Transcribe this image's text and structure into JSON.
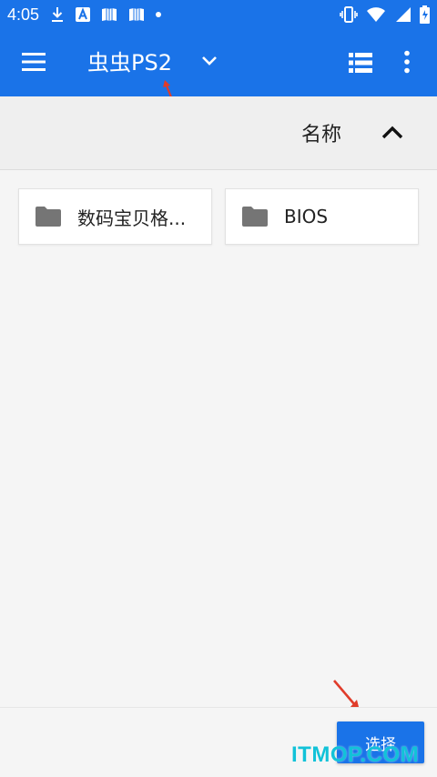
{
  "status_bar": {
    "time": "4:05",
    "icons": [
      "download-icon",
      "a-badge-icon",
      "book-icon",
      "book-icon",
      "dot-icon",
      "vibrate-icon",
      "wifi-icon",
      "signal-icon",
      "battery-icon"
    ]
  },
  "app_bar": {
    "title": "虫虫PS2",
    "icons": [
      "menu-icon",
      "chevron-down-icon",
      "list-view-icon",
      "more-vert-icon"
    ],
    "color": "#1a73e8"
  },
  "sort_bar": {
    "label": "名称",
    "direction_icon": "chevron-up-icon"
  },
  "items": [
    {
      "name": "数码宝贝格...",
      "icon": "folder-icon"
    },
    {
      "name": "BIOS",
      "icon": "folder-icon"
    }
  ],
  "bottom_bar": {
    "select_label": "选择"
  },
  "watermark": "ITMOP.COM"
}
